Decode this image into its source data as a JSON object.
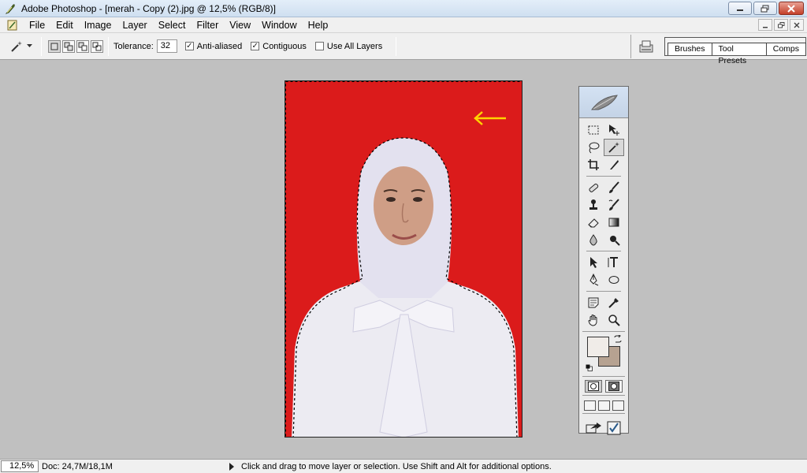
{
  "window": {
    "title": "Adobe Photoshop - [merah - Copy (2).jpg @ 12,5% (RGB/8)]"
  },
  "menu": {
    "items": [
      "File",
      "Edit",
      "Image",
      "Layer",
      "Select",
      "Filter",
      "View",
      "Window",
      "Help"
    ]
  },
  "options": {
    "tolerance_label": "Tolerance:",
    "tolerance_value": "32",
    "anti_aliased_label": "Anti-aliased",
    "anti_aliased_checked": true,
    "contiguous_label": "Contiguous",
    "contiguous_checked": true,
    "use_all_layers_label": "Use All Layers",
    "use_all_layers_checked": false
  },
  "palette_well": {
    "tabs": [
      "Brushes",
      "Tool Presets",
      "Comps"
    ]
  },
  "canvas": {
    "background_color": "#db1b1b",
    "annotation_arrow_color": "#ffd400"
  },
  "toolbox": {
    "foreground_color": "#f0ece8",
    "background_color": "#b6a291",
    "active_tool": "magic-wand"
  },
  "status": {
    "zoom": "12,5%",
    "doc_info": "Doc: 24,7M/18,1M",
    "hint": "Click and drag to move layer or selection.  Use Shift and Alt for additional options."
  }
}
